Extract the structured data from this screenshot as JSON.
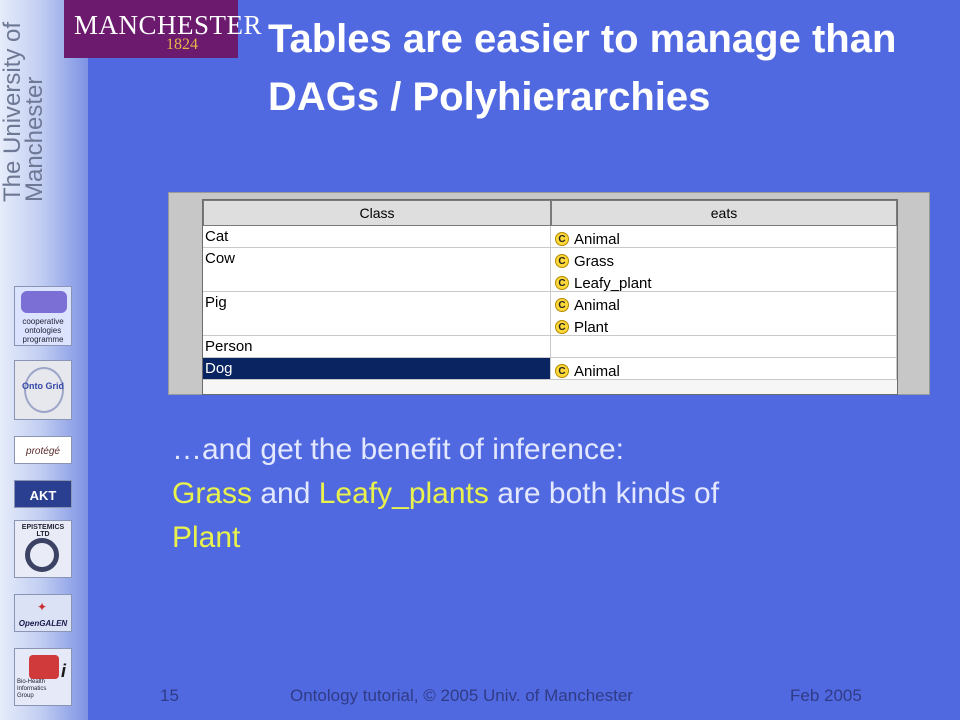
{
  "logo": {
    "name": "MANCHESTER",
    "year": "1824",
    "vertical_text": "The University of Manchester"
  },
  "partners": {
    "co_ode": [
      "cooperative",
      "ontologies",
      "programme"
    ],
    "ontogrid": "Onto Grid",
    "protege": "protégé",
    "akt": "AKT",
    "episteme": "EPISTEMICS LTD",
    "opengalen": "OpenGALEN",
    "bhig": [
      "Bio-Health",
      "Informatics",
      "Group"
    ]
  },
  "slide": {
    "title": "Tables are easier to manage than DAGs / Polyhierarchies",
    "body_line1": "…and get the benefit of inference:",
    "grass": "Grass",
    "and": " and ",
    "leafy": "Leafy_plants",
    "rest": " are both kinds of ",
    "plant": "Plant"
  },
  "table": {
    "headers": [
      "Class",
      "eats"
    ],
    "class_icon": "C",
    "rows": [
      {
        "class": "Cat",
        "eats": [
          "Animal"
        ]
      },
      {
        "class": "Cow",
        "eats": [
          "Grass",
          "Leafy_plant"
        ]
      },
      {
        "class": "Pig",
        "eats": [
          "Animal",
          "Plant"
        ]
      },
      {
        "class": "Person",
        "eats": []
      },
      {
        "class": "Dog",
        "eats": [
          "Animal"
        ],
        "selected": true
      }
    ]
  },
  "footer": {
    "page": "15",
    "center": "Ontology tutorial, © 2005 Univ. of Manchester",
    "date": "Feb 2005"
  },
  "colors": {
    "background": "#5169e0",
    "highlight": "#e9f24c",
    "selection": "#0a2462"
  }
}
